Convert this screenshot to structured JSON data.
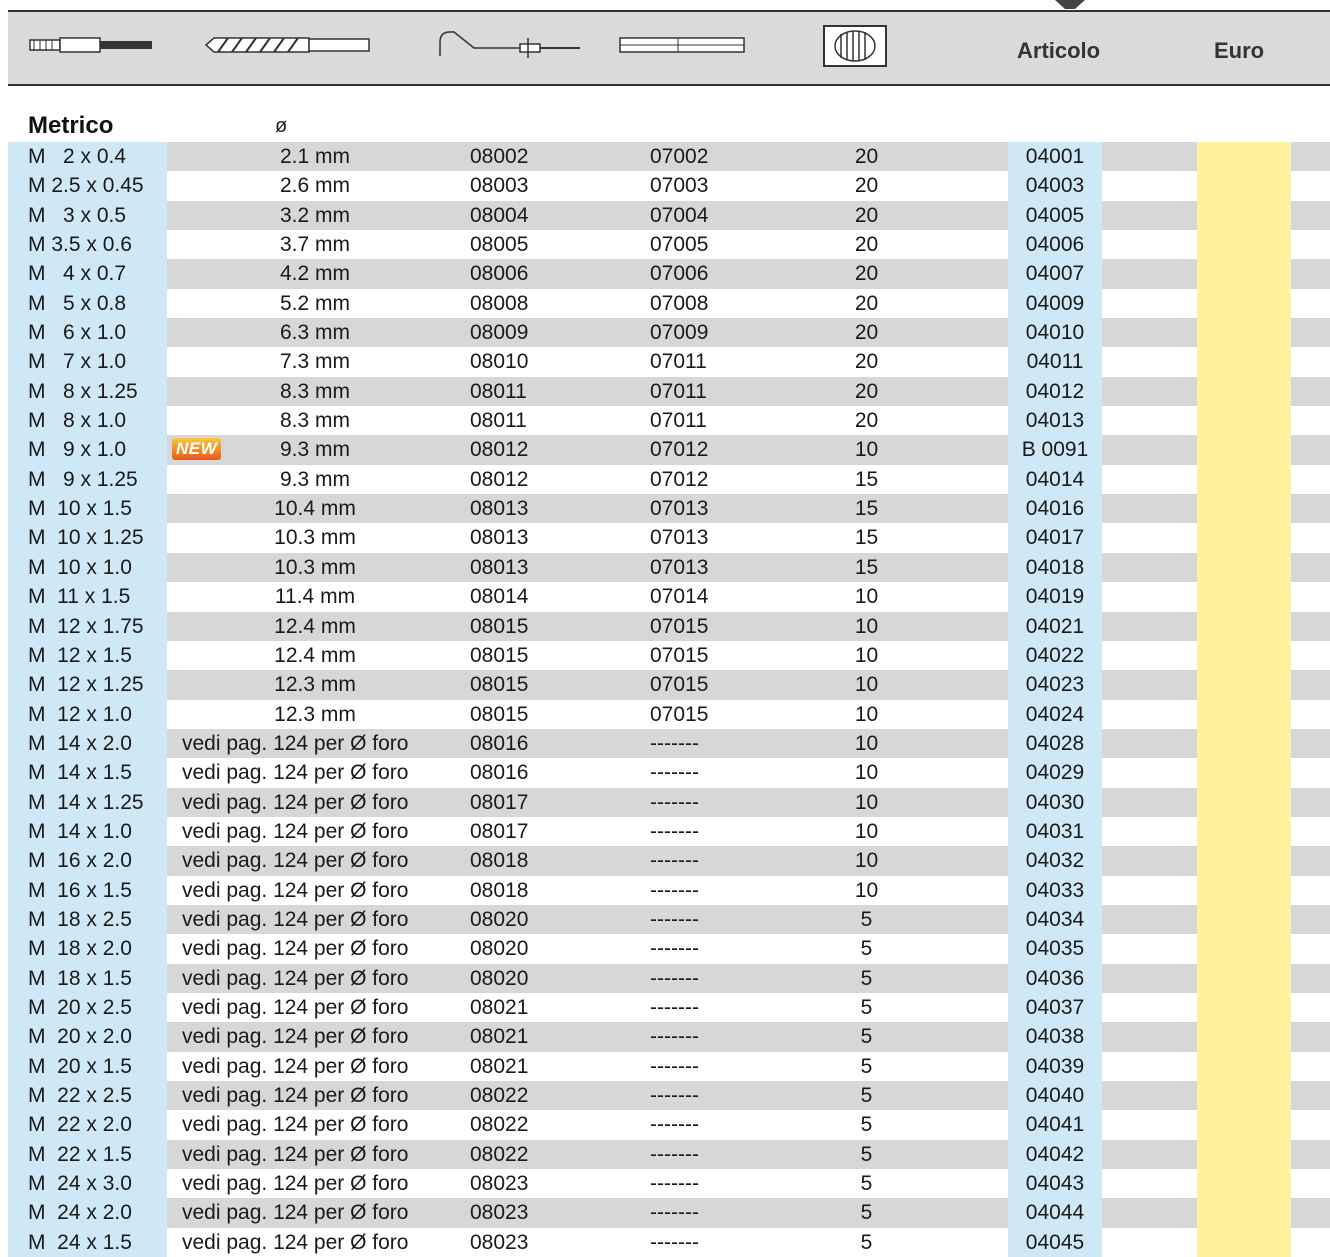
{
  "header": {
    "icons": [
      "tap-icon",
      "drill-bit-icon",
      "tap-wrench-icon",
      "extension-icon",
      "insert-coil-icon"
    ],
    "articolo": "Articolo",
    "euro": "Euro"
  },
  "section": {
    "title": "Metrico",
    "diameter_symbol": "ø"
  },
  "badge_text": "NEW",
  "rows": [
    {
      "thread": "M   2 x 0.4",
      "drill": "2.1 mm",
      "tap": "08002",
      "ext": "07002",
      "qty": "20",
      "art": "04001"
    },
    {
      "thread": "M 2.5 x 0.45",
      "drill": "2.6 mm",
      "tap": "08003",
      "ext": "07003",
      "qty": "20",
      "art": "04003"
    },
    {
      "thread": "M   3 x 0.5",
      "drill": "3.2 mm",
      "tap": "08004",
      "ext": "07004",
      "qty": "20",
      "art": "04005"
    },
    {
      "thread": "M 3.5 x 0.6",
      "drill": "3.7 mm",
      "tap": "08005",
      "ext": "07005",
      "qty": "20",
      "art": "04006"
    },
    {
      "thread": "M   4 x 0.7",
      "drill": "4.2 mm",
      "tap": "08006",
      "ext": "07006",
      "qty": "20",
      "art": "04007"
    },
    {
      "thread": "M   5 x 0.8",
      "drill": "5.2 mm",
      "tap": "08008",
      "ext": "07008",
      "qty": "20",
      "art": "04009"
    },
    {
      "thread": "M   6 x 1.0",
      "drill": "6.3 mm",
      "tap": "08009",
      "ext": "07009",
      "qty": "20",
      "art": "04010"
    },
    {
      "thread": "M   7 x 1.0",
      "drill": "7.3 mm",
      "tap": "08010",
      "ext": "07011",
      "qty": "20",
      "art": "04011"
    },
    {
      "thread": "M   8 x 1.25",
      "drill": "8.3 mm",
      "tap": "08011",
      "ext": "07011",
      "qty": "20",
      "art": "04012"
    },
    {
      "thread": "M   8 x 1.0",
      "drill": "8.3 mm",
      "tap": "08011",
      "ext": "07011",
      "qty": "20",
      "art": "04013"
    },
    {
      "thread": "M   9 x 1.0",
      "drill": "9.3 mm",
      "tap": "08012",
      "ext": "07012",
      "qty": "10",
      "art": "B 0091",
      "new": true
    },
    {
      "thread": "M   9 x 1.25",
      "drill": "9.3 mm",
      "tap": "08012",
      "ext": "07012",
      "qty": "15",
      "art": "04014"
    },
    {
      "thread": "M  10 x 1.5",
      "drill": "10.4 mm",
      "tap": "08013",
      "ext": "07013",
      "qty": "15",
      "art": "04016"
    },
    {
      "thread": "M  10 x 1.25",
      "drill": "10.3 mm",
      "tap": "08013",
      "ext": "07013",
      "qty": "15",
      "art": "04017"
    },
    {
      "thread": "M  10 x 1.0",
      "drill": "10.3 mm",
      "tap": "08013",
      "ext": "07013",
      "qty": "15",
      "art": "04018"
    },
    {
      "thread": "M  11 x 1.5",
      "drill": "11.4 mm",
      "tap": "08014",
      "ext": "07014",
      "qty": "10",
      "art": "04019"
    },
    {
      "thread": "M  12 x 1.75",
      "drill": "12.4 mm",
      "tap": "08015",
      "ext": "07015",
      "qty": "10",
      "art": "04021"
    },
    {
      "thread": "M  12 x 1.5",
      "drill": "12.4 mm",
      "tap": "08015",
      "ext": "07015",
      "qty": "10",
      "art": "04022"
    },
    {
      "thread": "M  12 x 1.25",
      "drill": "12.3 mm",
      "tap": "08015",
      "ext": "07015",
      "qty": "10",
      "art": "04023"
    },
    {
      "thread": "M  12 x 1.0",
      "drill": "12.3 mm",
      "tap": "08015",
      "ext": "07015",
      "qty": "10",
      "art": "04024"
    },
    {
      "thread": "M  14 x 2.0",
      "drill": "vedi pag. 124 per Ø foro",
      "tap": "08016",
      "ext": "-------",
      "qty": "10",
      "art": "04028",
      "vedi": true
    },
    {
      "thread": "M  14 x 1.5",
      "drill": "vedi pag. 124 per Ø foro",
      "tap": "08016",
      "ext": "-------",
      "qty": "10",
      "art": "04029",
      "vedi": true
    },
    {
      "thread": "M  14 x 1.25",
      "drill": "vedi pag. 124 per Ø foro",
      "tap": "08017",
      "ext": "-------",
      "qty": "10",
      "art": "04030",
      "vedi": true
    },
    {
      "thread": "M  14 x 1.0",
      "drill": "vedi pag. 124 per Ø foro",
      "tap": "08017",
      "ext": "-------",
      "qty": "10",
      "art": "04031",
      "vedi": true
    },
    {
      "thread": "M  16 x 2.0",
      "drill": "vedi pag. 124 per Ø foro",
      "tap": "08018",
      "ext": "-------",
      "qty": "10",
      "art": "04032",
      "vedi": true
    },
    {
      "thread": "M  16 x 1.5",
      "drill": "vedi pag. 124 per Ø foro",
      "tap": "08018",
      "ext": "-------",
      "qty": "10",
      "art": "04033",
      "vedi": true
    },
    {
      "thread": "M  18 x 2.5",
      "drill": "vedi pag. 124 per Ø foro",
      "tap": "08020",
      "ext": "-------",
      "qty": "5",
      "art": "04034",
      "vedi": true
    },
    {
      "thread": "M  18 x 2.0",
      "drill": "vedi pag. 124 per Ø foro",
      "tap": "08020",
      "ext": "-------",
      "qty": "5",
      "art": "04035",
      "vedi": true
    },
    {
      "thread": "M  18 x 1.5",
      "drill": "vedi pag. 124 per Ø foro",
      "tap": "08020",
      "ext": "-------",
      "qty": "5",
      "art": "04036",
      "vedi": true
    },
    {
      "thread": "M  20 x 2.5",
      "drill": "vedi pag. 124 per Ø foro",
      "tap": "08021",
      "ext": "-------",
      "qty": "5",
      "art": "04037",
      "vedi": true
    },
    {
      "thread": "M  20 x 2.0",
      "drill": "vedi pag. 124 per Ø foro",
      "tap": "08021",
      "ext": "-------",
      "qty": "5",
      "art": "04038",
      "vedi": true
    },
    {
      "thread": "M  20 x 1.5",
      "drill": "vedi pag. 124 per Ø foro",
      "tap": "08021",
      "ext": "-------",
      "qty": "5",
      "art": "04039",
      "vedi": true
    },
    {
      "thread": "M  22 x 2.5",
      "drill": "vedi pag. 124 per Ø foro",
      "tap": "08022",
      "ext": "-------",
      "qty": "5",
      "art": "04040",
      "vedi": true
    },
    {
      "thread": "M  22 x 2.0",
      "drill": "vedi pag. 124 per Ø foro",
      "tap": "08022",
      "ext": "-------",
      "qty": "5",
      "art": "04041",
      "vedi": true
    },
    {
      "thread": "M  22 x 1.5",
      "drill": "vedi pag. 124 per Ø foro",
      "tap": "08022",
      "ext": "-------",
      "qty": "5",
      "art": "04042",
      "vedi": true
    },
    {
      "thread": "M  24 x 3.0",
      "drill": "vedi pag. 124 per Ø foro",
      "tap": "08023",
      "ext": "-------",
      "qty": "5",
      "art": "04043",
      "vedi": true
    },
    {
      "thread": "M  24 x 2.0",
      "drill": "vedi pag. 124 per Ø foro",
      "tap": "08023",
      "ext": "-------",
      "qty": "5",
      "art": "04044",
      "vedi": true
    },
    {
      "thread": "M  24 x 1.5",
      "drill": "vedi pag. 124 per Ø foro",
      "tap": "08023",
      "ext": "-------",
      "qty": "5",
      "art": "04045",
      "vedi": true
    }
  ]
}
